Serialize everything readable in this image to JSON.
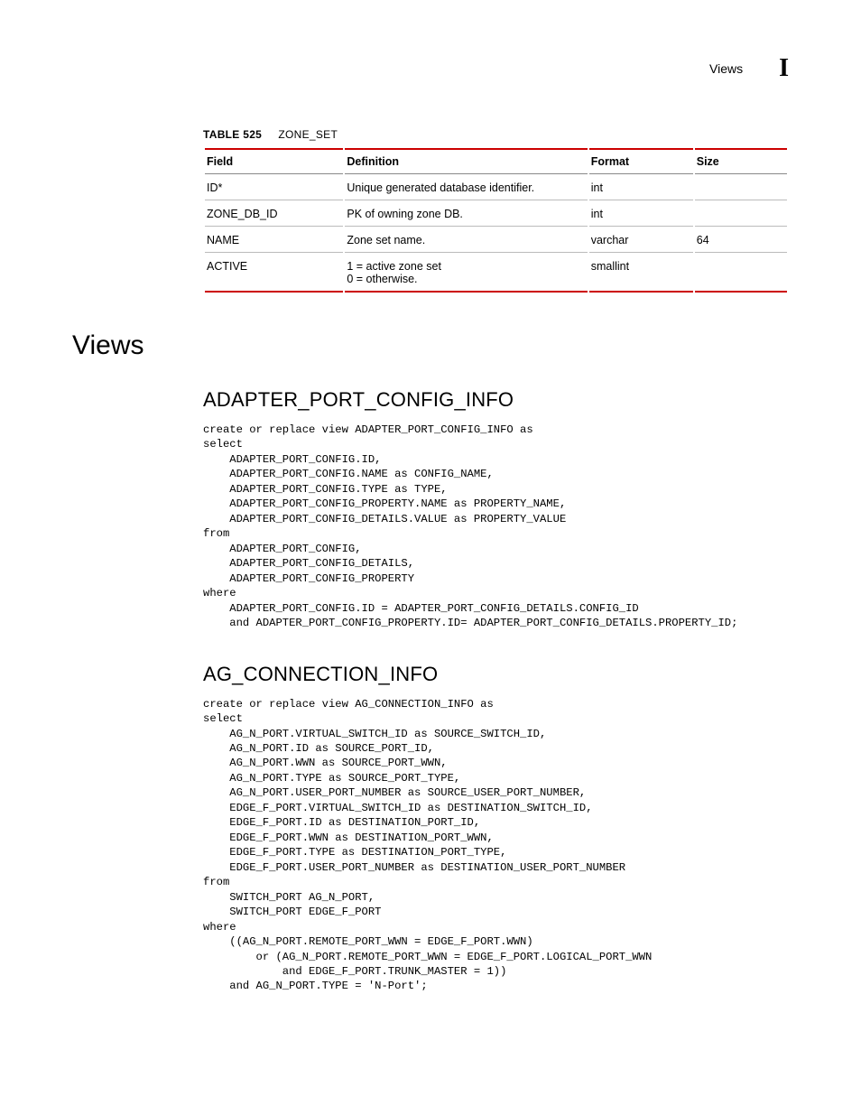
{
  "header": {
    "label": "Views",
    "marker": "I"
  },
  "table": {
    "caption_prefix": "TABLE 525",
    "caption_name": "ZONE_SET",
    "headers": {
      "field": "Field",
      "definition": "Definition",
      "format": "Format",
      "size": "Size"
    },
    "rows": [
      {
        "field": "ID*",
        "definition": "Unique generated database identifier.",
        "format": "int",
        "size": ""
      },
      {
        "field": "ZONE_DB_ID",
        "definition": "PK of owning zone DB.",
        "format": "int",
        "size": ""
      },
      {
        "field": "NAME",
        "definition": "Zone set name.",
        "format": "varchar",
        "size": "64"
      },
      {
        "field": "ACTIVE",
        "definition": "1 = active zone set\n0 = otherwise.",
        "format": "smallint",
        "size": ""
      }
    ]
  },
  "section_title": "Views",
  "views": [
    {
      "title": "ADAPTER_PORT_CONFIG_INFO",
      "code": "create or replace view ADAPTER_PORT_CONFIG_INFO as\nselect\n    ADAPTER_PORT_CONFIG.ID,\n    ADAPTER_PORT_CONFIG.NAME as CONFIG_NAME,\n    ADAPTER_PORT_CONFIG.TYPE as TYPE,\n    ADAPTER_PORT_CONFIG_PROPERTY.NAME as PROPERTY_NAME,\n    ADAPTER_PORT_CONFIG_DETAILS.VALUE as PROPERTY_VALUE\nfrom\n    ADAPTER_PORT_CONFIG,\n    ADAPTER_PORT_CONFIG_DETAILS,\n    ADAPTER_PORT_CONFIG_PROPERTY\nwhere\n    ADAPTER_PORT_CONFIG.ID = ADAPTER_PORT_CONFIG_DETAILS.CONFIG_ID\n    and ADAPTER_PORT_CONFIG_PROPERTY.ID= ADAPTER_PORT_CONFIG_DETAILS.PROPERTY_ID;"
    },
    {
      "title": "AG_CONNECTION_INFO",
      "code": "create or replace view AG_CONNECTION_INFO as\nselect\n    AG_N_PORT.VIRTUAL_SWITCH_ID as SOURCE_SWITCH_ID,\n    AG_N_PORT.ID as SOURCE_PORT_ID,\n    AG_N_PORT.WWN as SOURCE_PORT_WWN,\n    AG_N_PORT.TYPE as SOURCE_PORT_TYPE,\n    AG_N_PORT.USER_PORT_NUMBER as SOURCE_USER_PORT_NUMBER,\n    EDGE_F_PORT.VIRTUAL_SWITCH_ID as DESTINATION_SWITCH_ID,\n    EDGE_F_PORT.ID as DESTINATION_PORT_ID,\n    EDGE_F_PORT.WWN as DESTINATION_PORT_WWN,\n    EDGE_F_PORT.TYPE as DESTINATION_PORT_TYPE,\n    EDGE_F_PORT.USER_PORT_NUMBER as DESTINATION_USER_PORT_NUMBER\nfrom\n    SWITCH_PORT AG_N_PORT,\n    SWITCH_PORT EDGE_F_PORT\nwhere\n    ((AG_N_PORT.REMOTE_PORT_WWN = EDGE_F_PORT.WWN)\n        or (AG_N_PORT.REMOTE_PORT_WWN = EDGE_F_PORT.LOGICAL_PORT_WWN\n            and EDGE_F_PORT.TRUNK_MASTER = 1))\n    and AG_N_PORT.TYPE = 'N-Port';"
    }
  ]
}
